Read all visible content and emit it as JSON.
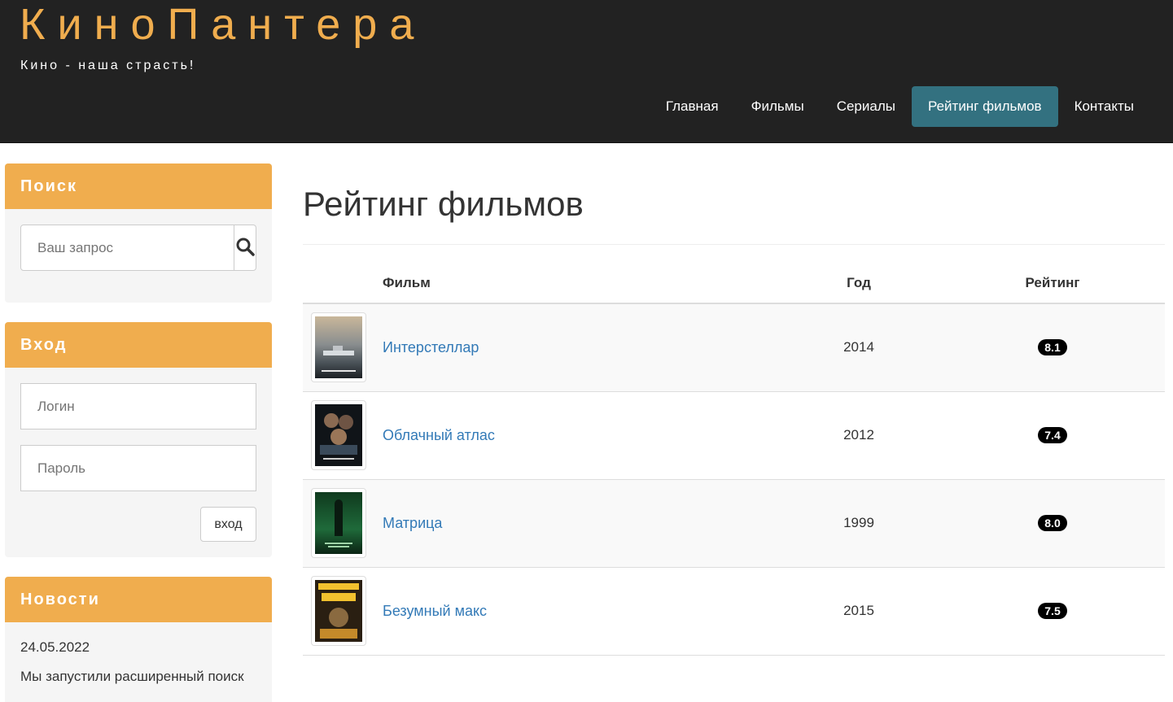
{
  "header": {
    "logo": "КиноПантера",
    "slogan": "Кино - наша страсть!",
    "nav": [
      "Главная",
      "Фильмы",
      "Сериалы",
      "Рейтинг фильмов",
      "Контакты"
    ],
    "active_nav": "Рейтинг фильмов",
    "brand_color": "#f0ad4e",
    "active_color": "#337180"
  },
  "sidebar": {
    "search": {
      "title": "Поиск",
      "placeholder": "Ваш запрос",
      "button_icon": "search-icon"
    },
    "login": {
      "title": "Вход",
      "login_placeholder": "Логин",
      "password_placeholder": "Пароль",
      "button": "вход"
    },
    "news": {
      "title": "Новости",
      "date": "24.05.2022",
      "text": "Мы запустили расширенный поиск"
    }
  },
  "main": {
    "title": "Рейтинг фильмов",
    "table": {
      "headers": {
        "film": "Фильм",
        "year": "Год",
        "rating": "Рейтинг"
      },
      "rows": [
        {
          "title": "Интерстеллар",
          "year": "2014",
          "rating": "8.1",
          "poster": "interstellar-poster"
        },
        {
          "title": "Облачный атлас",
          "year": "2012",
          "rating": "7.4",
          "poster": "cloud-atlas-poster"
        },
        {
          "title": "Матрица",
          "year": "1999",
          "rating": "8.0",
          "poster": "matrix-poster"
        },
        {
          "title": "Безумный макс",
          "year": "2015",
          "rating": "7.5",
          "poster": "mad-max-poster"
        }
      ]
    }
  }
}
